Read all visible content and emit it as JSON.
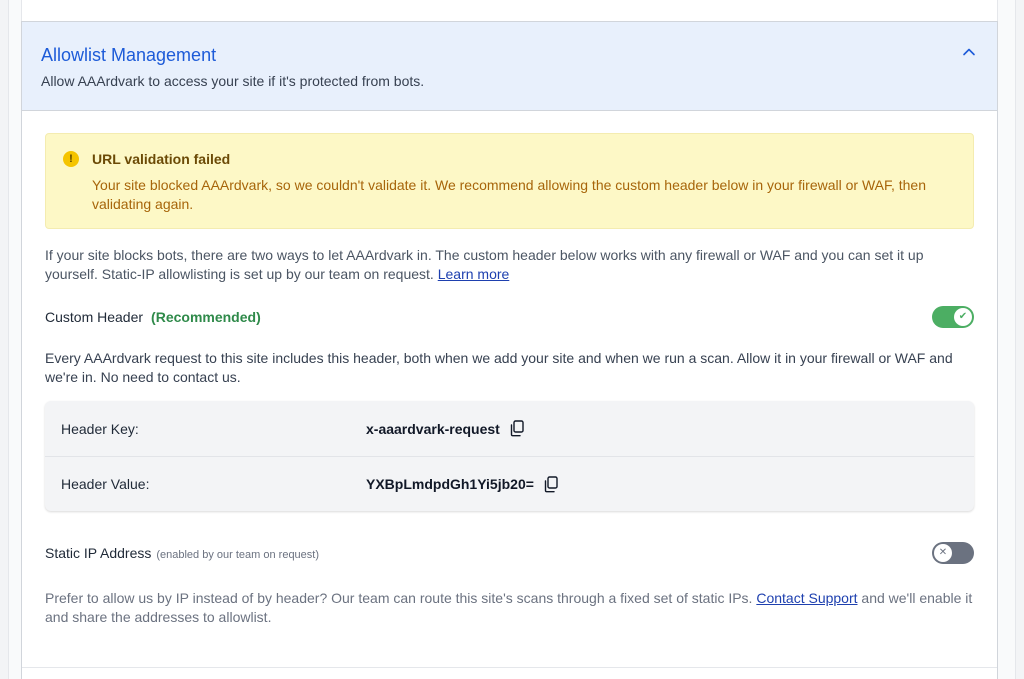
{
  "allowlist": {
    "title": "Allowlist Management",
    "subtitle": "Allow AAArdvark to access your site if it's protected from bots."
  },
  "alert": {
    "icon": "exclamation-circle-icon",
    "icon_glyph": "!",
    "title": "URL validation failed",
    "message": "Your site blocked AAArdvark, so we couldn't validate it. We recommend allowing the custom header below in your firewall or WAF, then validating again."
  },
  "intro": {
    "text": "If your site blocks bots, there are two ways to let AAArdvark in. The custom header below works with any firewall or WAF and you can set it up yourself. Static-IP allowlisting is set up by our team on request.",
    "link_label": "Learn more"
  },
  "custom_header": {
    "label": "Custom Header",
    "badge": "(Recommended)",
    "enabled": true,
    "description": "Every AAArdvark request to this site includes this header, both when we add your site and when we run a scan. Allow it in your firewall or WAF and we're in. No need to contact us.",
    "key_label": "Header Key:",
    "key_value": "x-aaardvark-request",
    "value_label": "Header Value:",
    "value_value": "YXBpLmdpdGh1Yi5jb20="
  },
  "static_ip": {
    "label": "Static IP Address",
    "hint": "(enabled by our team on request)",
    "enabled": false,
    "text_before": "Prefer to allow us by IP instead of by header? Our team can route this site's scans through a fixed set of static IPs.",
    "link_label": "Contact Support",
    "text_after": "and we'll enable it and share the addresses to allowlist."
  },
  "colors": {
    "title_blue": "#1d5bd8",
    "header_bg": "#e8f0fc",
    "alert_bg": "#fdf8c6",
    "alert_icon": "#f5c400",
    "toggle_on": "#4cae63",
    "toggle_off": "#6b7280",
    "recommended_green": "#2f8a4a"
  }
}
